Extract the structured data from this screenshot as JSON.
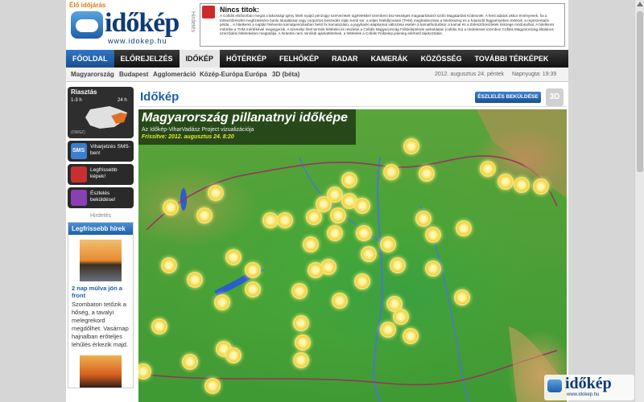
{
  "header": {
    "badge": "Élő időjárás",
    "logo": "időkép",
    "logo_url": "www.idokep.hu",
    "ad_label": "Hirdetés",
    "notice_title": "Nincs titok:",
    "notice_text": "A Cofidis elsősorban megát a lakossági igény hitelt nyújtó pénzügyi szervezetek ügyfeleikkel szembeni tisz-tességes magatartásáról szóló Magatartási Kódexnek. A fenti adatok akkor érvényesek, ha a törlesztőrészlet megfizetésére banki átutalással vagy csoportos beszedés útján kerül sor, a teljes hiteldíjmutató (THM) meghatározása a hitelösszeg és a futamidő függvényében történik, a reprezentatív példa... A hitelkeret a naptári felévente kamatperiódusban belül fix kamatozású, a jegybanki alapkamat változása esetén a kamatfordulókor a kamat és a törlesztőrészletek összege módosulhat. A hitelkeret mértéke a THM mértékével megegyezik. A személyi hitel termék feltételei és részletei a Cofidis Magyarország Fiókteleptének weboldalán (cofidis.hu) a hirdetéssel szemben Cofidis Magyarország általános szerződési feltételeiben megtalálja. A hirdetés nem minősül ajánlattételnek, a feltételek a Cofidis Fióktelep jelenleg elérhető tájékoztatás."
  },
  "nav": [
    "FŐOLDAL",
    "ELŐREJELZÉS",
    "IDŐKÉP",
    "HŐTÉRKÉP",
    "FELHŐKÉP",
    "RADAR",
    "KAMERÁK",
    "KÖZÖSSÉG",
    "TOVÁBBI TÉRKÉPEK"
  ],
  "subnav": {
    "items": [
      "Magyarország",
      "Budapest",
      "Agglomeráció",
      "Közép-Európa",
      "Európa",
      "3D (béta)"
    ],
    "date": "2012. augusztus 24. péntek",
    "sunset": "Napnyugta: 19:39"
  },
  "sidebar": {
    "widget_title": "Riasztás",
    "widget_range_left": "1-3 h",
    "widget_range_right": "24 h",
    "widget_footer": "(OMSZ)",
    "btn_sms": "Viharjelzés SMS-ben!",
    "btn_photo": "Legfrissebb képek!",
    "btn_report": "Észlelés beküldése!",
    "ad_label": "Hirdetés",
    "news_title": "Legfrissebb hírek",
    "news_item_title": "2 nap múlva jön a front",
    "news_item_text": "Szombaton tetőzik a hőség, a tavalyi melegrekord megdőlhet. Vasárnap hajnalban erőteljes lehűlés érkezik majd."
  },
  "content": {
    "title": "Időkép",
    "report_btn": "ÉSZLELÉS BEKÜLDÉSE",
    "btn_3d": "3D",
    "map_title": "Magyarország pillanatnyi időképe",
    "map_sub": "Az Időkép-ViharVadász Project vizualizációja",
    "map_fresh": "Frissítve: 2012. augusztus 24. 8:20"
  },
  "corner": {
    "logo": "időkép",
    "url": "www.idokep.hu"
  },
  "colors": {
    "brand": "#0e3b74",
    "accent": "#1e5fa8",
    "nav_dark": "#111111"
  },
  "map_icons": "sun-icon"
}
